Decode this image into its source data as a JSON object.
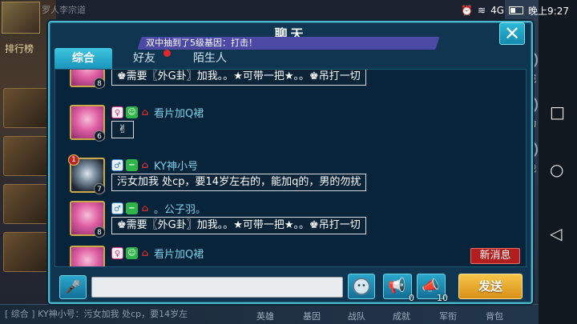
{
  "status_bar": {
    "time": "晚上9:27",
    "signal_label": "4G"
  },
  "background": {
    "top_left_text": "罗人李宗道",
    "ranking_label": "排行榜",
    "right_buttons": [
      "商城",
      "活动",
      "观战"
    ],
    "bottom_tabs": [
      "英雄",
      "基因",
      "战队",
      "成就",
      "军衔",
      "背包"
    ],
    "bottom_chat": "[ 综合 ] KY神小号：污女加我 处cp，要14岁左"
  },
  "dialog": {
    "title": "聊天",
    "marquee": "双中抽到了5级基因：打击！",
    "tabs": [
      {
        "label": "综合",
        "active": true
      },
      {
        "label": "好友",
        "active": false
      },
      {
        "label": "陌生人",
        "active": false
      }
    ],
    "messages": [
      {
        "name": "",
        "level": "8",
        "text": "♚需要〖外G卦〗加我。。★可带一把★。。♚吊打一切",
        "avatar": "pink",
        "gender": "female"
      },
      {
        "name": "看片加Q裙",
        "level": "6",
        "text": "✌",
        "avatar": "pink",
        "gender": "female"
      },
      {
        "name": "KY神小号",
        "level": "7",
        "rank": "1",
        "text": "污女加我 处cp，要14岁左右的，能加q的，男的勿扰",
        "avatar": "dark",
        "gender": "male"
      },
      {
        "name": "。公子羽。",
        "level": "8",
        "text": "♚需要〖外G卦〗加我。。★可带一把★。。♚吊打一切",
        "avatar": "pink",
        "gender": "male"
      },
      {
        "name": "看片加Q裙",
        "level": "",
        "text": "",
        "avatar": "pink",
        "gender": "female"
      }
    ],
    "new_message_label": "新消息",
    "input_placeholder": "",
    "horn_small_count": "0",
    "horn_large_count": "10",
    "send_label": "发送"
  }
}
